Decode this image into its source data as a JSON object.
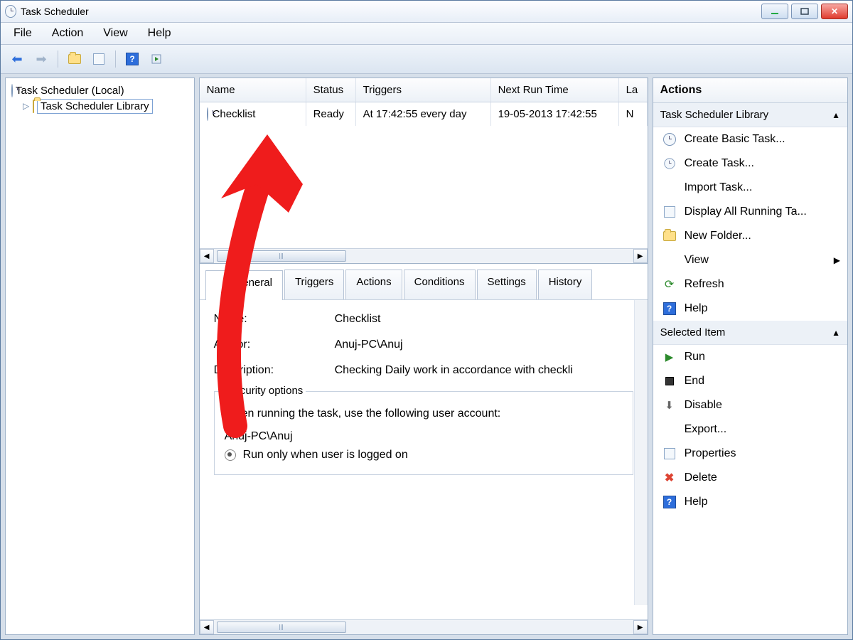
{
  "window": {
    "title": "Task Scheduler"
  },
  "menu": {
    "items": [
      "File",
      "Action",
      "View",
      "Help"
    ]
  },
  "tree": {
    "root": "Task Scheduler (Local)",
    "child": "Task Scheduler Library"
  },
  "grid": {
    "headers": {
      "name": "Name",
      "status": "Status",
      "triggers": "Triggers",
      "next": "Next Run Time",
      "last": "La"
    },
    "row": {
      "name": "Checklist",
      "status": "Ready",
      "triggers": "At 17:42:55 every day",
      "next": "19-05-2013 17:42:55",
      "last": "N"
    }
  },
  "tabs": [
    "General",
    "Triggers",
    "Actions",
    "Conditions",
    "Settings",
    "History"
  ],
  "detail": {
    "labels": {
      "name": "Name:",
      "author": "Author:",
      "description": "Description:"
    },
    "name": "Checklist",
    "author": "Anuj-PC\\Anuj",
    "description": "Checking Daily work in accordance with checkli",
    "security": {
      "legend": "Security options",
      "prompt": "When running the task, use the following user account:",
      "account": "Anuj-PC\\Anuj",
      "radio": "Run only when user is logged on"
    }
  },
  "actions": {
    "title": "Actions",
    "section1": "Task Scheduler Library",
    "items1": [
      "Create Basic Task...",
      "Create Task...",
      "Import Task...",
      "Display All Running Ta...",
      "New Folder...",
      "View",
      "Refresh",
      "Help"
    ],
    "section2": "Selected Item",
    "items2": [
      "Run",
      "End",
      "Disable",
      "Export...",
      "Properties",
      "Delete",
      "Help"
    ]
  }
}
